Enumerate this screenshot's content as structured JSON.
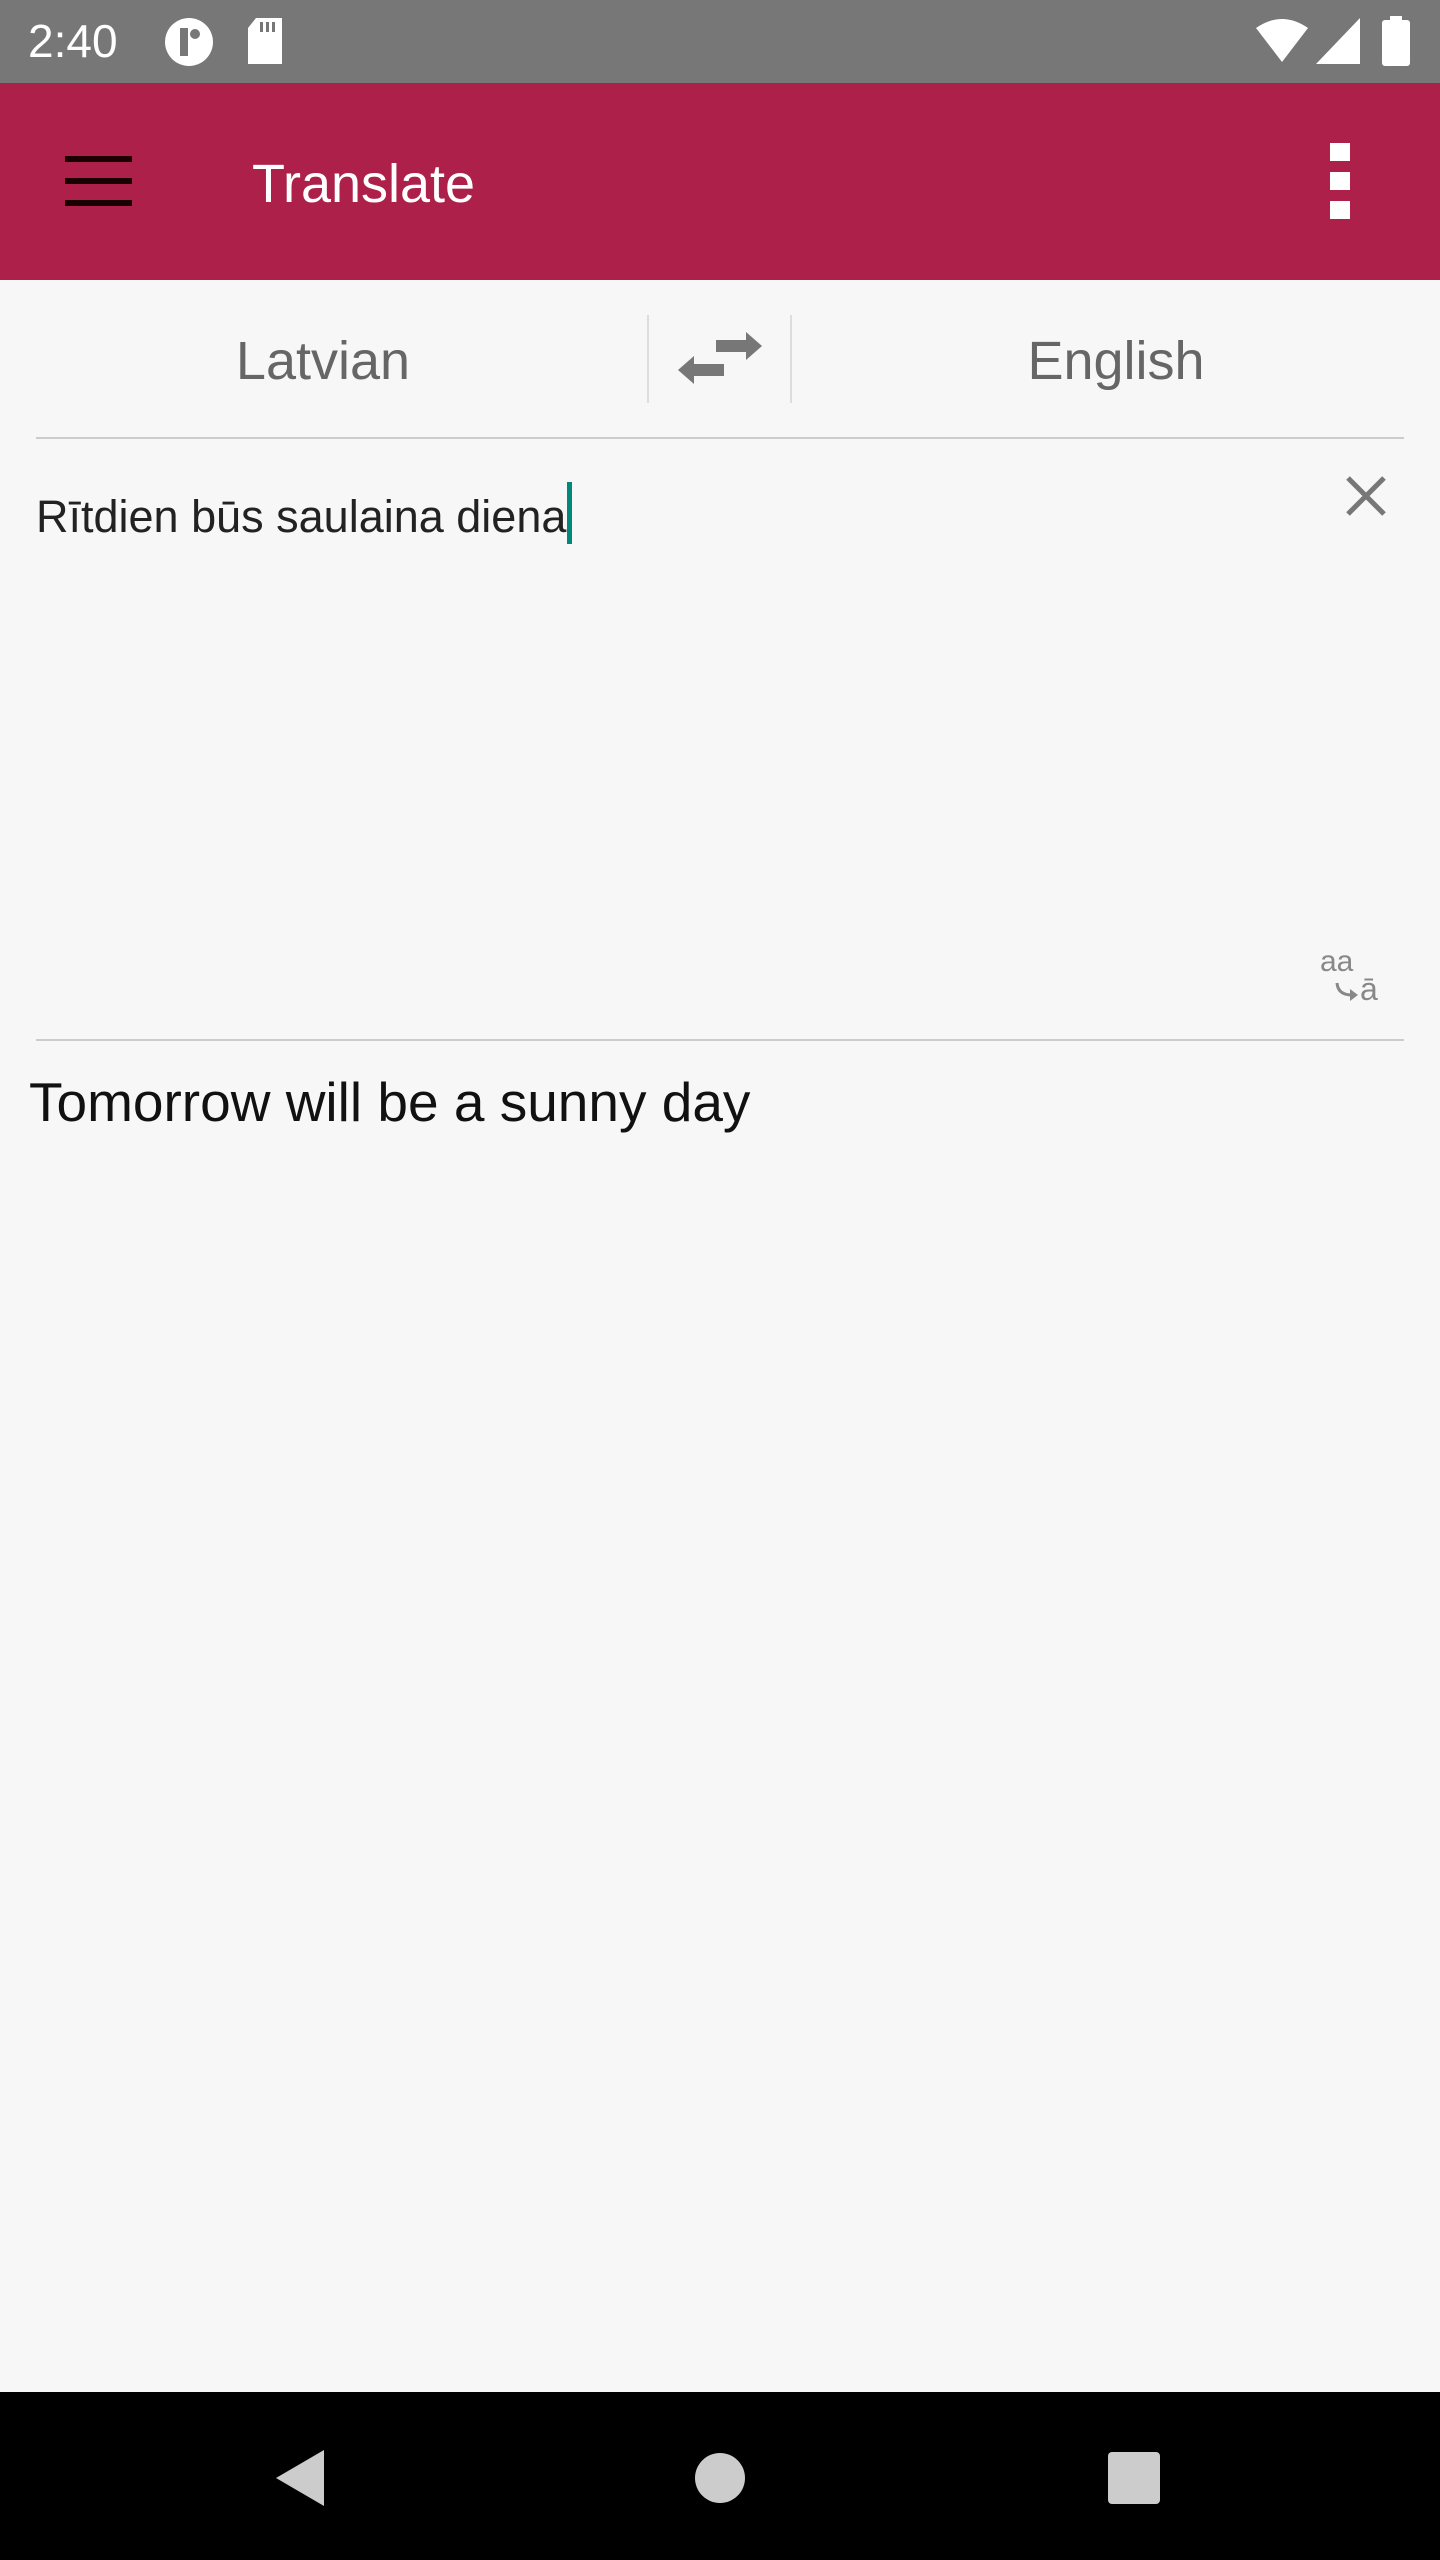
{
  "status_bar": {
    "time": "2:40",
    "icons": [
      "notification-icon",
      "sd-card-icon",
      "wifi-icon",
      "signal-icon",
      "battery-icon"
    ]
  },
  "app_bar": {
    "title": "Translate",
    "color": "#ad2049"
  },
  "languages": {
    "source": "Latvian",
    "target": "English"
  },
  "input": {
    "value": "Rītdien būs saulaina diena",
    "cursor_color": "#00897b"
  },
  "output": {
    "value": "Tomorrow will be a sunny day"
  },
  "translit_icon": {
    "top": "aa",
    "bottom": "ā"
  }
}
